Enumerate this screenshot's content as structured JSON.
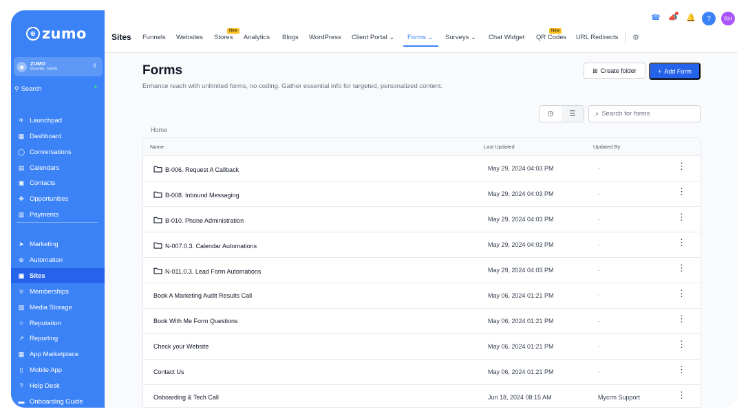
{
  "brand": {
    "logo_text": "zumo"
  },
  "location": {
    "name": "ZUMO",
    "sub": "Penrith, NSW"
  },
  "sidebar": {
    "search_label": "Search",
    "items": [
      {
        "label": "Launchpad",
        "icon": "rocket-icon"
      },
      {
        "label": "Dashboard",
        "icon": "grid-icon"
      },
      {
        "label": "Conversations",
        "icon": "chat-icon"
      },
      {
        "label": "Calendars",
        "icon": "calendar-icon"
      },
      {
        "label": "Contacts",
        "icon": "contacts-icon"
      },
      {
        "label": "Opportunities",
        "icon": "opportunities-icon"
      },
      {
        "label": "Payments",
        "icon": "payments-icon"
      },
      {
        "label": "Marketing",
        "icon": "send-icon"
      },
      {
        "label": "Automation",
        "icon": "automation-icon"
      },
      {
        "label": "Sites",
        "icon": "sites-icon",
        "active": true
      },
      {
        "label": "Memberships",
        "icon": "award-icon"
      },
      {
        "label": "Media Storage",
        "icon": "image-icon"
      },
      {
        "label": "Reputation",
        "icon": "star-icon"
      },
      {
        "label": "Reporting",
        "icon": "chart-line-icon"
      },
      {
        "label": "App Marketplace",
        "icon": "apps-icon"
      },
      {
        "label": "Mobile App",
        "icon": "mobile-icon"
      },
      {
        "label": "Help Desk",
        "icon": "help-icon"
      },
      {
        "label": "Onboarding Guide",
        "icon": "book-icon"
      }
    ]
  },
  "topbar": {
    "section_title": "Sites",
    "tabs": [
      {
        "label": "Funnels"
      },
      {
        "label": "Websites"
      },
      {
        "label": "Stores",
        "badge": "New"
      },
      {
        "label": "Analytics"
      },
      {
        "label": "Blogs"
      },
      {
        "label": "WordPress"
      },
      {
        "label": "Client Portal"
      },
      {
        "label": "Forms",
        "active": true
      },
      {
        "label": "Surveys"
      },
      {
        "label": "Chat Widget"
      },
      {
        "label": "QR Codes",
        "badge": "New"
      },
      {
        "label": "URL Redirects"
      }
    ],
    "help_label": "?",
    "user_initials": "RH"
  },
  "main": {
    "title": "Forms",
    "subtitle": "Enhance reach with unlimited forms, no coding. Gather essential info for targeted, personalized content.",
    "create_folder_label": "Create folder",
    "add_form_label": "Add Form",
    "search_placeholder": "Search for forms",
    "breadcrumb": "Home",
    "columns": {
      "name": "Name",
      "last_updated": "Last Updated",
      "updated_by": "Updated By"
    },
    "rows": [
      {
        "name": "B-006. Request A Callback",
        "folder": true,
        "updated": "May 29, 2024 04:03 PM",
        "by": "-"
      },
      {
        "name": "B-008. Inbound Messaging",
        "folder": true,
        "updated": "May 29, 2024 04:03 PM",
        "by": "-"
      },
      {
        "name": "B-010. Phone Administration",
        "folder": true,
        "updated": "May 29, 2024 04:03 PM",
        "by": "-"
      },
      {
        "name": "N-007.0.3. Calendar Automations",
        "folder": true,
        "updated": "May 29, 2024 04:03 PM",
        "by": "-"
      },
      {
        "name": "N-011.0.3. Lead Form Automations",
        "folder": true,
        "updated": "May 29, 2024 04:03 PM",
        "by": "-"
      },
      {
        "name": "Book A Marketing Audit Results Call",
        "folder": false,
        "updated": "May 06, 2024 01:21 PM",
        "by": "-"
      },
      {
        "name": "Book With Me Form Questions",
        "folder": false,
        "updated": "May 06, 2024 01:21 PM",
        "by": "-"
      },
      {
        "name": "Check your Website",
        "folder": false,
        "updated": "May 06, 2024 01:21 PM",
        "by": "-"
      },
      {
        "name": "Contact Us",
        "folder": false,
        "updated": "May 06, 2024 01:21 PM",
        "by": "-"
      },
      {
        "name": "Onboarding & Tech Call",
        "folder": false,
        "updated": "Jun 18, 2024 08:15 AM",
        "by": "Mycrm Support"
      }
    ]
  },
  "colors": {
    "sidebar": "#3b82f6",
    "accent": "#2563eb",
    "active_tab": "#3b82f6",
    "badge": "#fbbf24"
  }
}
